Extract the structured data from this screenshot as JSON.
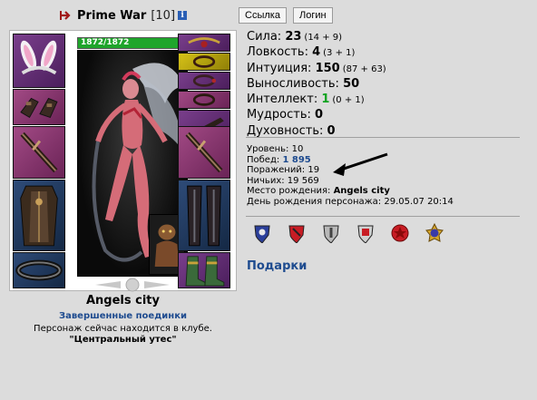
{
  "header": {
    "name": "Prime War",
    "level": "[10]",
    "info_glyph": "i",
    "link_button": "Ссылка",
    "login_button": "Логин"
  },
  "character": {
    "hp_text": "1872/1872",
    "hp_fraction": 1.0,
    "equipment_left": [
      "ears-headgear-icon",
      "gloves-icon",
      "sword-icon",
      "armor-icon",
      "belt-icon"
    ],
    "equipment_right": [
      "amulet-icon",
      "ring-icon",
      "ring-icon",
      "ring-icon",
      "rifle-icon",
      "sword-icon",
      "leg-armor-icon",
      "boots-icon"
    ]
  },
  "location": {
    "city": "Angels city",
    "fights_link": "Завершенные поединки",
    "club_text": "Персонаж сейчас находится в клубе.",
    "club_name": "\"Центральный утес\""
  },
  "stats": [
    {
      "label": "Сила:",
      "value": "23",
      "extra": "(14 + 9)"
    },
    {
      "label": "Ловкость:",
      "value": "4",
      "extra": "(3 + 1)"
    },
    {
      "label": "Интуиция:",
      "value": "150",
      "extra": "(87 + 63)"
    },
    {
      "label": "Выносливость:",
      "value": "50",
      "extra": ""
    },
    {
      "label": "Интеллект:",
      "value": "1",
      "extra": "(0 + 1)"
    },
    {
      "label": "Мудрость:",
      "value": "0",
      "extra": ""
    },
    {
      "label": "Духовность:",
      "value": "0",
      "extra": ""
    }
  ],
  "info": {
    "level": "Уровень: 10",
    "wins_label": "Побед:",
    "wins_value": "1 895",
    "losses": "Поражений: 19",
    "draws": "Ничьих: 19 569",
    "birthplace_label": "Место рождения:",
    "birthplace_value": "Angels city",
    "birthday": "День рождения персонажа: 29.05.07 20:14"
  },
  "badges": [
    "shield-blue-icon",
    "shield-red-icon",
    "shield-gray-icon",
    "shield-red-gray-icon",
    "red-star-icon",
    "blue-star-icon"
  ],
  "gifts_link": "Подарки",
  "colors": {
    "background": "#dcdcdc",
    "link": "#1e4b8f",
    "hp": "#1fa52b",
    "intellect": "#12a321"
  }
}
